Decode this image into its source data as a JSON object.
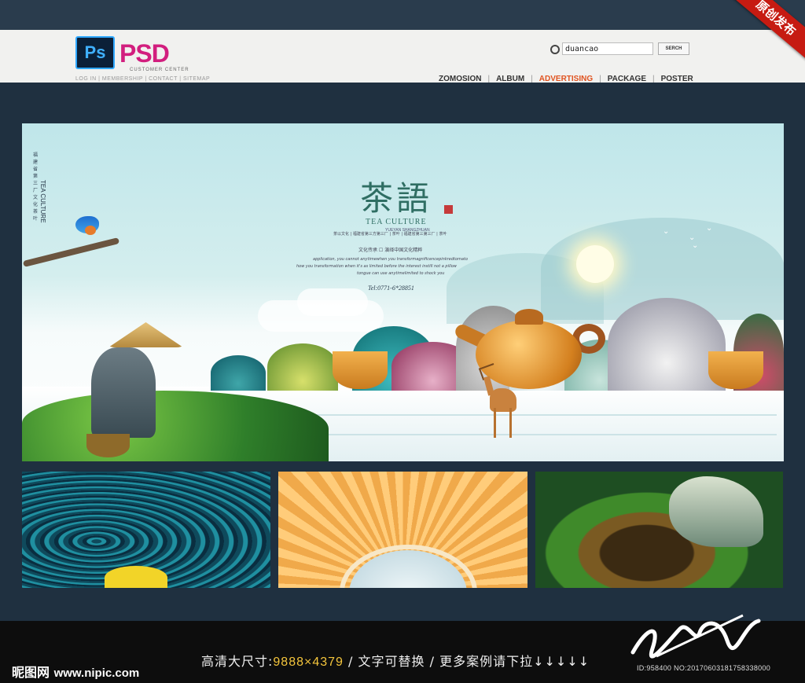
{
  "header": {
    "logo_icon_text": "Ps",
    "logo_text": "PSD",
    "logo_subtext": "CUSTOMER CENTER",
    "top_links": "LOG IN | MEMBERSHIP | CONTACT | SITEMAP",
    "search": {
      "value": "duancao",
      "button": "SERCH"
    },
    "nav": [
      {
        "label": "ZOMOSION",
        "active": false
      },
      {
        "label": "ALBUM",
        "active": false
      },
      {
        "label": "ADVERTISING",
        "active": true
      },
      {
        "label": "PACKAGE",
        "active": false
      },
      {
        "label": "POSTER",
        "active": false
      }
    ],
    "corner_badge": "原创发布"
  },
  "poster": {
    "title_cn": "茶語",
    "title_en": "TEA CULTURE",
    "title_en_sub": "YUEYAN SHANGZHUAN",
    "line_1": "茶以文化 | 福建省第三方第三厂 | 茶叶 | 福建省第三第三厂 | 茶叶",
    "line_2": "文化传承 ☐ 演绎中国文化精粹",
    "line_3": "application, you cannot anytimewhen you transformagnificencepinkredtomato",
    "line_4": "how you transformation when it's as limited before the interest instill not a pillow",
    "line_5": "tongue can use anytimelimited to shock you",
    "phone": "Tel:0771-6*28851",
    "vertical_cn": "福建省第三厂文化茶叶",
    "vertical_en": "TEA CULTURE"
  },
  "footer": {
    "brand": "昵图网",
    "brand_url": "www.nipic.com",
    "caption_prefix": "高清大尺寸:",
    "caption_size": "9888×4379",
    "caption_suffix": " / 文字可替换 / 更多案例请下拉↓↓↓↓↓",
    "id_line": "ID:958400 NO:20170603181758338000"
  },
  "colors": {
    "background": "#1f3040",
    "accent": "#c61b12",
    "nav_active": "#e05320",
    "logo_pink": "#d21e7e"
  }
}
